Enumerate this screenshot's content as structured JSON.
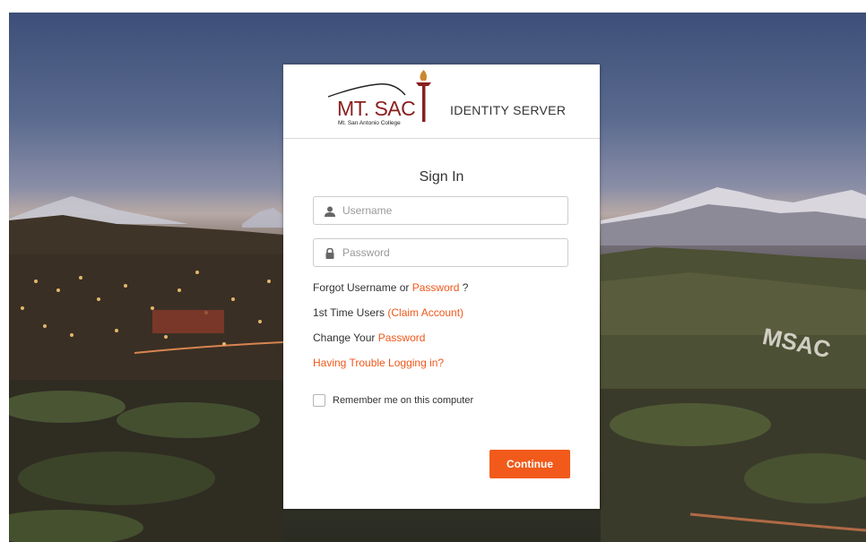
{
  "header": {
    "logo_text": "MT. SAC",
    "logo_subtitle": "Mt. San Antonio College",
    "title": "IDENTITY SERVER"
  },
  "signin": {
    "title": "Sign In",
    "username_placeholder": "Username",
    "password_placeholder": "Password"
  },
  "links": {
    "forgot_prefix": "Forgot Username or",
    "forgot_link": "Password",
    "forgot_suffix": "?",
    "first_time_prefix": "1st Time Users",
    "claim_link": "(Claim Account)",
    "change_prefix": "Change Your",
    "change_link": "Password",
    "trouble_link": "Having Trouble Logging in?"
  },
  "remember": {
    "label": "Remember me on this computer",
    "checked": false
  },
  "actions": {
    "continue_label": "Continue"
  },
  "colors": {
    "accent": "#f15a1a",
    "link": "#f0571b",
    "logo": "#8a1f1f"
  }
}
